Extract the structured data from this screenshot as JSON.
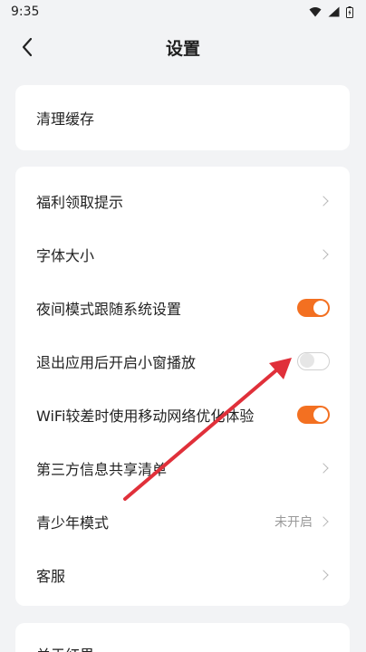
{
  "status_bar": {
    "time": "9:35",
    "icons": [
      "wifi-icon",
      "signal-icon",
      "battery-icon"
    ]
  },
  "nav": {
    "back_icon": "chevron-left-icon",
    "title": "设置"
  },
  "cache_section": {
    "clear_cache_label": "清理缓存"
  },
  "settings": {
    "welfare_tips": {
      "label": "福利领取提示",
      "control": "chevron"
    },
    "font_size": {
      "label": "字体大小",
      "control": "chevron"
    },
    "night_mode_follow_system": {
      "label": "夜间模式跟随系统设置",
      "control": "toggle",
      "enabled": true
    },
    "mini_window_on_exit": {
      "label": "退出应用后开启小窗播放",
      "control": "toggle",
      "enabled": false
    },
    "wifi_weak_mobile_optimize": {
      "label": "WiFi较差时使用移动网络优化体验",
      "control": "toggle",
      "enabled": true
    },
    "third_party_sharing": {
      "label": "第三方信息共享清单",
      "control": "chevron"
    },
    "teen_mode": {
      "label": "青少年模式",
      "value": "未开启",
      "control": "chevron"
    },
    "customer_service": {
      "label": "客服",
      "control": "chevron"
    }
  },
  "about_section": {
    "about_label": "关于红果"
  },
  "colors": {
    "accent": "#f37021",
    "annotation_arrow": "#e0303a",
    "background": "#f2f3f5",
    "card": "#ffffff"
  }
}
